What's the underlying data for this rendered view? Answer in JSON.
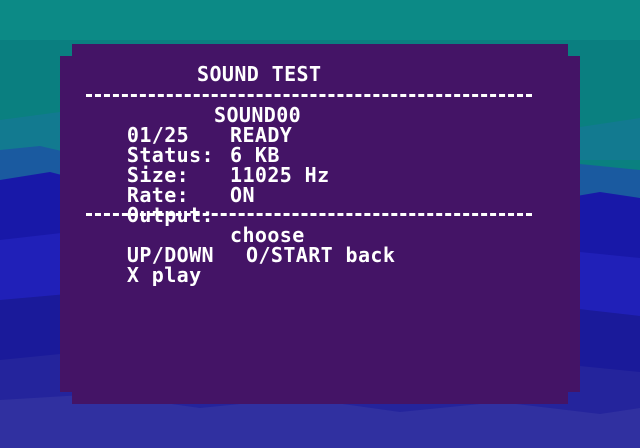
{
  "screen": {
    "title": "SOUND TEST",
    "track_counter": "01/25",
    "track_name": "SOUND00",
    "status_label": "Status:",
    "status_value": "READY",
    "size_label": "Size:",
    "size_value": "6 KB",
    "rate_label": "Rate:",
    "rate_value": "11025 Hz",
    "output_label": "Output:",
    "output_value": "ON",
    "help_updown": "UP/DOWN",
    "help_choose": "choose",
    "help_xplay": "X play",
    "help_back": "O/START back"
  },
  "colors": {
    "panel": "#441466",
    "text": "#ffffff",
    "sky": "#0a8080",
    "clouds": "#1818a8"
  }
}
